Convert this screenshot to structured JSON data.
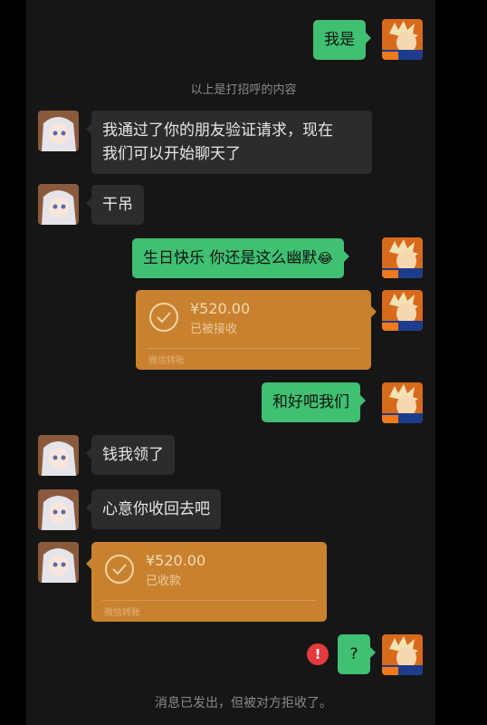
{
  "messages": [
    {
      "text": "我是"
    },
    {
      "text": "我通过了你的朋友验证请求，现在"
    },
    {
      "text": "我们可以开始聊天了"
    },
    {
      "text": "干吊"
    },
    {
      "text": "生日快乐 你还是这么幽默"
    },
    {
      "text": "和好吧我们"
    },
    {
      "text": "钱我领了"
    },
    {
      "text": "心意你收回去吧"
    },
    {
      "text": "?"
    }
  ],
  "system": {
    "greeting_notice": "以上是打招呼的内容",
    "rejected_notice": "消息已发出，但被对方拒收了。"
  },
  "transfers": [
    {
      "amount": "¥520.00",
      "status": "已被接收",
      "footer": "微信转账"
    },
    {
      "amount": "¥520.00",
      "status": "已收款",
      "footer": "微信转账"
    }
  ],
  "emoji": {
    "laugh": "😂"
  },
  "icons": {
    "error": "!"
  },
  "colors": {
    "background": "#161616",
    "bubble_incoming": "#2c2c2c",
    "bubble_outgoing": "#3fc072",
    "transfer_card": "#c8822f",
    "error": "#e33b3b"
  }
}
